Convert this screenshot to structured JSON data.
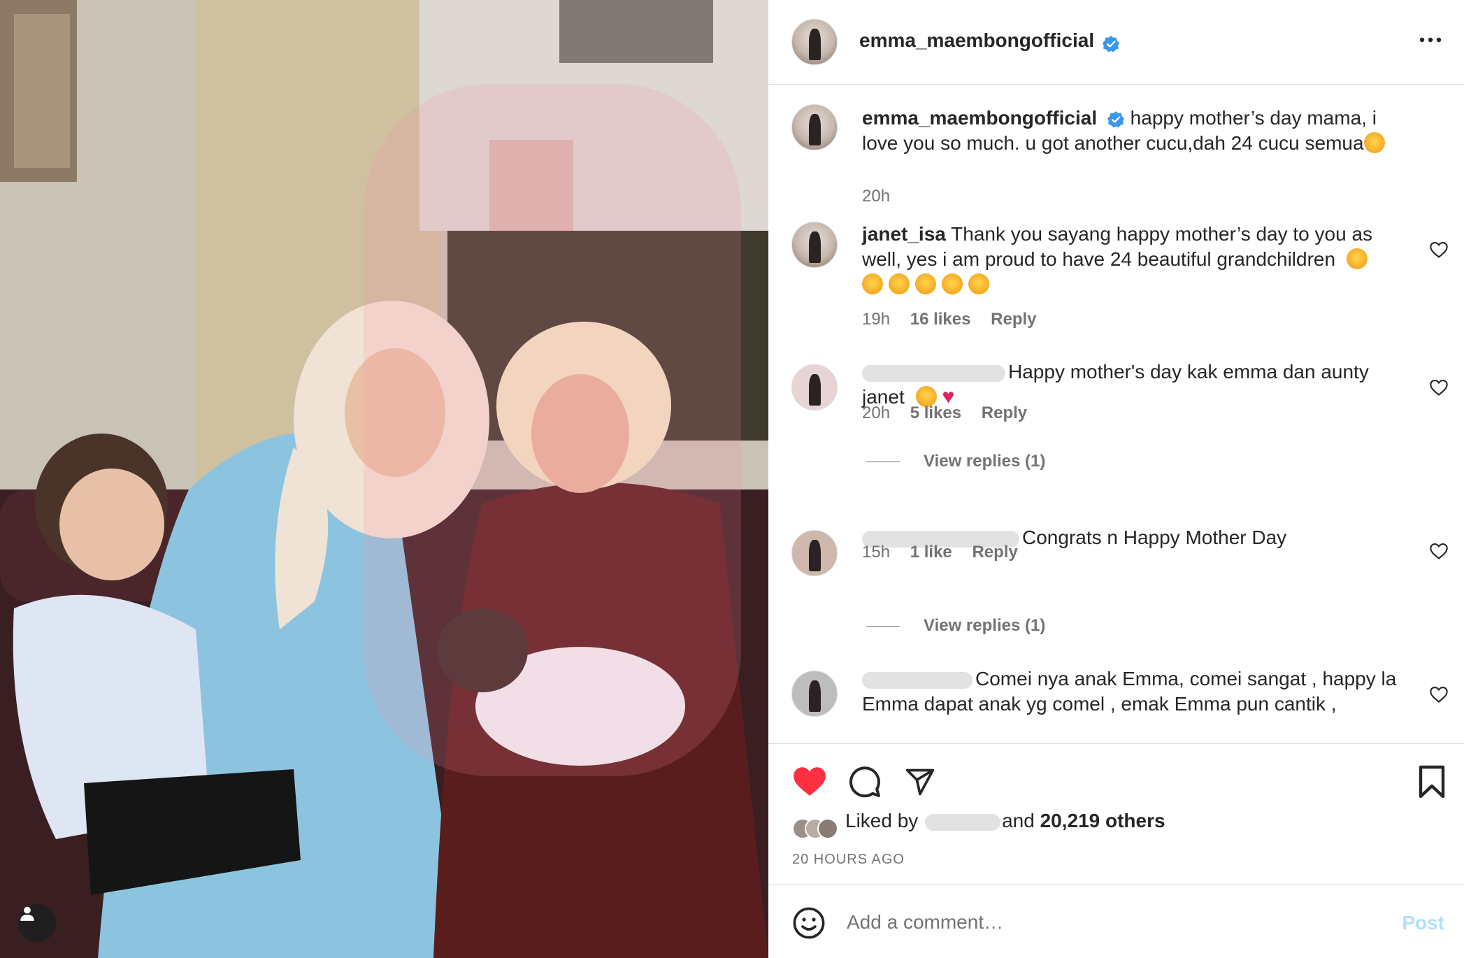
{
  "post": {
    "author": "emma_maembongofficial",
    "verified": true,
    "caption": "happy mother’s day mama, i love you so much. u got another cucu,dah 24 cucu semua",
    "caption_time": "20h"
  },
  "comments": [
    {
      "user": "janet_isa",
      "text": "Thank you sayang happy mother’s day to you as well, yes i am proud to have 24 beautiful grandchildren",
      "time": "19h",
      "likes": "16 likes",
      "reply": "Reply"
    },
    {
      "user": "",
      "text": "Happy mother's day kak emma dan aunty janet",
      "time": "20h",
      "likes": "5 likes",
      "reply": "Reply",
      "view_replies": "View replies (1)"
    },
    {
      "user": "",
      "text": "Congrats n Happy Mother Day",
      "time": "15h",
      "likes": "1 like",
      "reply": "Reply",
      "view_replies": "View replies (1)"
    },
    {
      "user": "",
      "text": "Comei nya anak Emma, comei sangat , happy la Emma dapat anak yg comel , emak Emma pun cantik ,"
    }
  ],
  "likes": {
    "prefix": "Liked by",
    "middle": "and",
    "count": "20,219 others"
  },
  "time_ago": "20 HOURS AGO",
  "add_comment": {
    "placeholder": "Add a comment…",
    "post_label": "Post"
  },
  "icons": {
    "like": "heart-filled-icon",
    "comment": "comment-icon",
    "share": "send-icon",
    "save": "bookmark-icon",
    "more": "more-icon",
    "emoji": "emoji-icon",
    "user_tag": "user-tag-icon"
  },
  "colors": {
    "like_red": "#ff3040",
    "verified_blue": "#3897f0",
    "post_disabled": "#b2dffc"
  }
}
